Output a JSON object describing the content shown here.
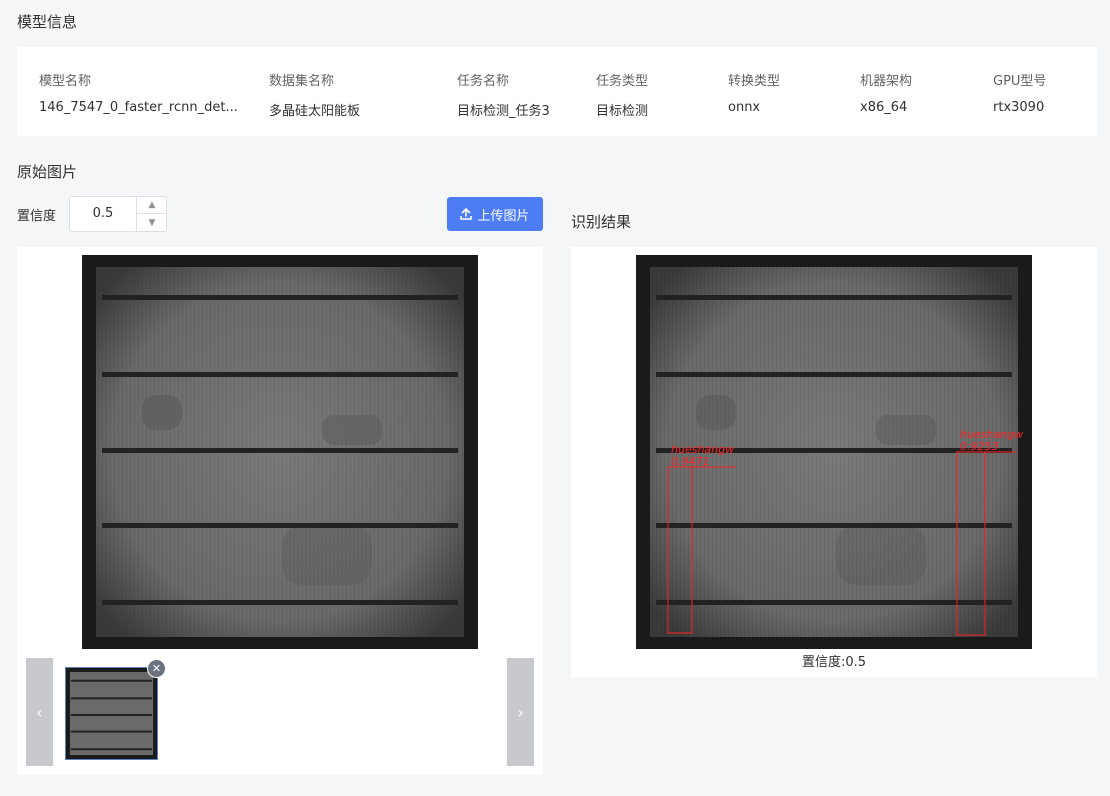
{
  "model_section": {
    "title": "模型信息",
    "columns": [
      {
        "header": "模型名称",
        "value": "146_7547_0_faster_rcnn_det..."
      },
      {
        "header": "数据集名称",
        "value": "多晶硅太阳能板"
      },
      {
        "header": "任务名称",
        "value": "目标检测_任务3"
      },
      {
        "header": "任务类型",
        "value": "目标检测"
      },
      {
        "header": "转换类型",
        "value": "onnx"
      },
      {
        "header": "机器架构",
        "value": "x86_64"
      },
      {
        "header": "GPU型号",
        "value": "rtx3090"
      }
    ]
  },
  "original_section": {
    "title": "原始图片",
    "confidence_label": "置信度",
    "confidence_value": "0.5",
    "upload_label": "上传图片"
  },
  "result_section": {
    "title": "识别结果",
    "caption": "置信度:0.5",
    "detections": [
      {
        "label": "hueshangw",
        "score": "0.9471"
      },
      {
        "label": "hueshangw",
        "score": "0.9253"
      }
    ]
  },
  "icons": {
    "upload": "upload-icon",
    "stepper_up": "chevron-up-icon",
    "stepper_down": "chevron-down-icon",
    "prev": "chevron-left-icon",
    "next": "chevron-right-icon",
    "remove": "close-circle-icon"
  },
  "colors": {
    "primary": "#4e7cf5",
    "detection_box": "#ff2020",
    "panel_bg": "#ffffff",
    "page_bg": "#f5f6f8"
  }
}
